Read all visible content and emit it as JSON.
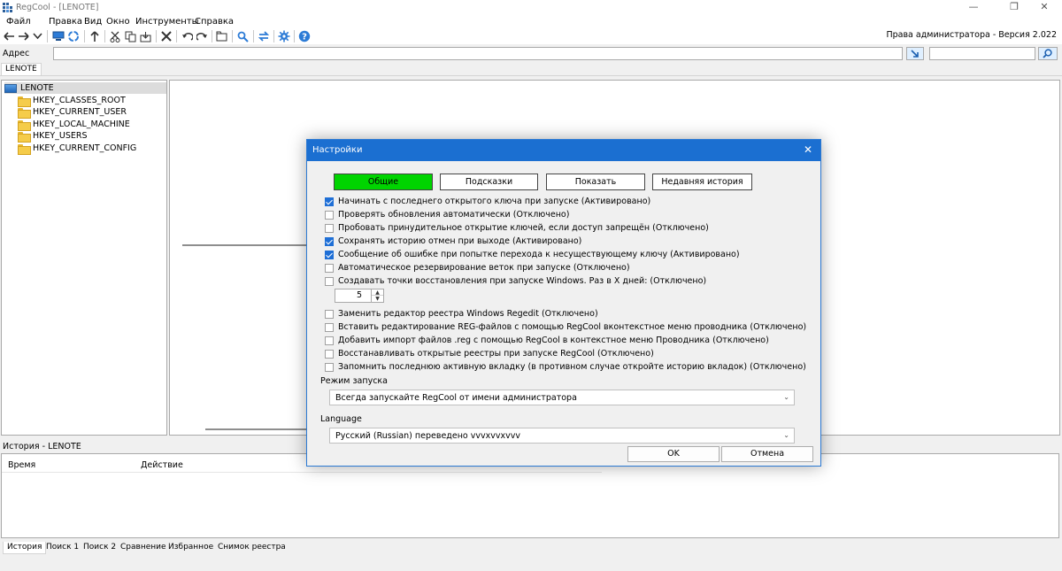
{
  "window": {
    "title": "RegCool - [LENOTE]",
    "controls": [
      "—",
      "❐",
      "✕"
    ]
  },
  "menu": [
    "Файл",
    "Правка",
    "Вид",
    "Окно",
    "Инструменты",
    "Справка"
  ],
  "toolbar": {
    "admin_version": "Права администратора - Версия 2.022",
    "icons": [
      "back-icon",
      "forward-icon",
      "dropdown-icon",
      "computer-icon",
      "refresh-icon",
      "up-icon",
      "cut-icon",
      "copy-icon",
      "export-icon",
      "delete-icon",
      "undo-icon",
      "redo-icon",
      "new-key-icon",
      "find-icon",
      "replace-icon",
      "settings-icon",
      "help-icon"
    ]
  },
  "address": {
    "label": "Адрес",
    "value": "",
    "search_value": ""
  },
  "doc_tab": "LENOTE",
  "tree": {
    "root": "LENOTE",
    "hives": [
      "HKEY_CLASSES_ROOT",
      "HKEY_CURRENT_USER",
      "HKEY_LOCAL_MACHINE",
      "HKEY_USERS",
      "HKEY_CURRENT_CONFIG"
    ]
  },
  "history": {
    "title": "История - LENOTE",
    "col_time": "Время",
    "col_action": "Действие"
  },
  "bottom_tabs": [
    "История",
    "Поиск 1",
    "Поиск 2",
    "Сравнение",
    "Избранное",
    "Снимок реестра"
  ],
  "dialog": {
    "title": "Настройки",
    "close": "✕",
    "tabs": [
      "Общие",
      "Подсказки",
      "Показать",
      "Недавняя история"
    ],
    "options": [
      {
        "label": "Начинать с последнего открытого ключа при запуске (Активировано)",
        "checked": true
      },
      {
        "label": "Проверять обновления автоматически (Отключено)",
        "checked": false
      },
      {
        "label": "Пробовать принудительное открытие ключей, если доступ запрещён (Отключено)",
        "checked": false
      },
      {
        "label": "Сохранять историю отмен при выходе (Активировано)",
        "checked": true
      },
      {
        "label": "Сообщение об ошибке при попытке перехода к несуществующему ключу (Активировано)",
        "checked": true
      },
      {
        "label": "Автоматическое резервирование веток при запуске (Отключено)",
        "checked": false
      },
      {
        "label": "Создавать точки восстановления при запуске Windows. Раз в X дней: (Отключено)",
        "checked": false
      }
    ],
    "restore_days": "5",
    "options2": [
      {
        "label": "Заменить редактор реестра Windows Regedit (Отключено)",
        "checked": false
      },
      {
        "label": "Вставить редактирование REG-файлов с помощью RegCool вконтекстное меню проводника (Отключено)",
        "checked": false
      },
      {
        "label": "Добавить импорт файлов .reg с помощью RegCool в контекстное меню Проводника (Отключено)",
        "checked": false
      },
      {
        "label": "Восстанавливать открытые реестры при запуске RegCool (Отключено)",
        "checked": false
      },
      {
        "label": "Запомнить последнюю активную вкладку (в противном случае откройте историю вкладок) (Отключено)",
        "checked": false
      }
    ],
    "launch_mode_label": "Режим запуска",
    "launch_mode_value": "Всегда запускайте RegCool от имени администратора",
    "language_label": "Language",
    "language_value": "Русский (Russian) переведено vvvxvvxvvv",
    "ok": "OK",
    "cancel": "Отмена"
  },
  "colors": {
    "accent": "#1b6fd1",
    "active_tab": "#00d400",
    "checkbox_on": "#1f6fd6"
  }
}
